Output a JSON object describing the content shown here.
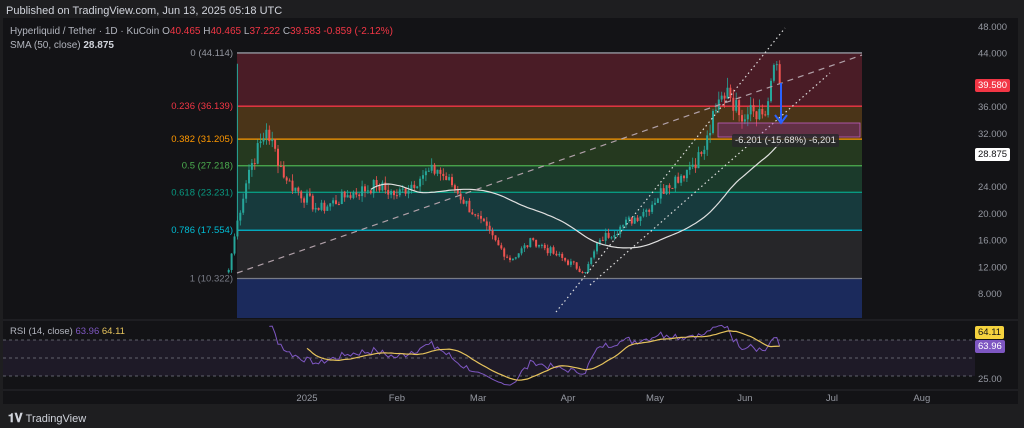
{
  "published": "Published on TradingView.com, Jun 13, 2025 05:18 UTC",
  "legend": {
    "symbol": "Hyperliquid / Tether · 1D · KuCoin",
    "o_label": "O",
    "o": "40.465",
    "h_label": "H",
    "h": "40.465",
    "l_label": "L",
    "l": "37.222",
    "c_label": "C",
    "c": "39.583",
    "change": "-0.859 (-2.12%)",
    "sma_label": "SMA (50, close)",
    "sma_value": "28.875"
  },
  "rsi": {
    "label": "RSI (14, close)",
    "value": "63.96",
    "ma_value": "64.11",
    "axis_label": "25.00"
  },
  "price_tags": {
    "last": "39.580",
    "sma": "28.875"
  },
  "measure_label": "-6.201 (-15.68%) -6,201",
  "footer": {
    "brand": "TradingView"
  },
  "colors": {
    "up": "#26a69a",
    "down": "#ef5350",
    "sma": "#e0e0e0",
    "rsi": "#7e57c2",
    "rsi_ma": "#e6c35c"
  },
  "chart_data": {
    "type": "candlestick",
    "y_ticks": [
      "48.000",
      "44.000",
      "36.000",
      "32.000",
      "24.000",
      "20.000",
      "16.000",
      "12.000",
      "8.000"
    ],
    "ylim": [
      8,
      48
    ],
    "x_ticks": [
      {
        "label": "2025",
        "date": "2025-01-01"
      },
      {
        "label": "Feb",
        "date": "2025-02-01"
      },
      {
        "label": "Mar",
        "date": "2025-03-01"
      },
      {
        "label": "Apr",
        "date": "2025-04-01"
      },
      {
        "label": "May",
        "date": "2025-05-01"
      },
      {
        "label": "Jun",
        "date": "2025-06-01"
      },
      {
        "label": "Jul",
        "date": "2025-07-01"
      },
      {
        "label": "Aug",
        "date": "2025-08-01"
      }
    ],
    "fib": [
      {
        "ratio": "0",
        "price": 44.114,
        "label": "0 (44.114)",
        "color": "#9598a1",
        "fill": "#4a1c26"
      },
      {
        "ratio": "0.236",
        "price": 36.139,
        "label": "0.236 (36.139)",
        "color": "#f23645",
        "fill": "#4a3418"
      },
      {
        "ratio": "0.382",
        "price": 31.205,
        "label": "0.382 (31.205)",
        "color": "#ff9800",
        "fill": "#25391f"
      },
      {
        "ratio": "0.5",
        "price": 27.218,
        "label": "0.5 (27.218)",
        "color": "#4caf50",
        "fill": "#1b3a2b"
      },
      {
        "ratio": "0.618",
        "price": 23.231,
        "label": "0.618 (23.231)",
        "color": "#089981",
        "fill": "#173a3d"
      },
      {
        "ratio": "0.786",
        "price": 17.554,
        "label": "0.786 (17.554)",
        "color": "#00bcd4",
        "fill": "#262629"
      },
      {
        "ratio": "1",
        "price": 10.322,
        "label": "1 (10.322)",
        "color": "#787b86",
        "fill": "#1b2a5c"
      }
    ],
    "close_path": [
      [
        "2024-12-05",
        11.6
      ],
      [
        "2024-12-08",
        19
      ],
      [
        "2024-12-12",
        26.6
      ],
      [
        "2024-12-18",
        32.6
      ],
      [
        "2024-12-25",
        25
      ],
      [
        "2025-01-05",
        20.6
      ],
      [
        "2025-01-15",
        22.8
      ],
      [
        "2025-01-25",
        24.3
      ],
      [
        "2025-02-01",
        22.8
      ],
      [
        "2025-02-10",
        25.8
      ],
      [
        "2025-02-15",
        26.6
      ],
      [
        "2025-02-20",
        24.3
      ],
      [
        "2025-02-28",
        19.8
      ],
      [
        "2025-03-08",
        15.3
      ],
      [
        "2025-03-12",
        13.1
      ],
      [
        "2025-03-20",
        16.1
      ],
      [
        "2025-03-28",
        13.8
      ],
      [
        "2025-04-07",
        11.3
      ],
      [
        "2025-04-12",
        16.1
      ],
      [
        "2025-04-20",
        18.3
      ],
      [
        "2025-04-28",
        20.6
      ],
      [
        "2025-05-05",
        24.3
      ],
      [
        "2025-05-12",
        26.6
      ],
      [
        "2025-05-18",
        29.6
      ],
      [
        "2025-05-22",
        35.6
      ],
      [
        "2025-05-26",
        38.9
      ],
      [
        "2025-05-30",
        34.8
      ],
      [
        "2025-06-03",
        36.3
      ],
      [
        "2025-06-08",
        34.8
      ],
      [
        "2025-06-11",
        42.3
      ],
      [
        "2025-06-13",
        39.58
      ]
    ]
  }
}
